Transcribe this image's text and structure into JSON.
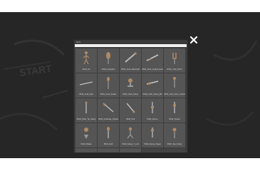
{
  "dialog": {
    "title": "Grid",
    "search_placeholder": "",
    "close_icon": "close-icon"
  },
  "colors": {
    "overlay": "#262626",
    "panel": "#3d3d3d",
    "tile": "#555555",
    "chalk": "#3a3a3a"
  },
  "background": {
    "chalk_text": "START"
  },
  "items": [
    {
      "label": "IPHD_03",
      "icon": "stick-figure-icon"
    },
    {
      "label": "IPHD_Ampedeo",
      "icon": "glove-icon"
    },
    {
      "label": "IPHD_Grab_Reanheld",
      "icon": "baton-icon"
    },
    {
      "label": "IPHD_Grab_Angled_Reach_Bat",
      "icon": "pointer-icon"
    },
    {
      "label": "IPHD_Grab_Pinch",
      "icon": "hand-icon"
    },
    {
      "label": "IPHD_Grab_Rod",
      "icon": "rod-icon"
    },
    {
      "label": "IPHD_Grab_Rotate",
      "icon": "wand-icon"
    },
    {
      "label": "IPHD_Grab_Swing",
      "icon": "lever-icon"
    },
    {
      "label": "IPHD_Grab_Swing_Mit",
      "icon": "pointer-icon"
    },
    {
      "label": "IPHD_Grab_Drive_Interlock",
      "icon": "figure-icon"
    },
    {
      "label": "IPHD_Draft_Tip_Swing",
      "icon": "needle-icon"
    },
    {
      "label": "IPHD_Clodinate_Plazed",
      "icon": "arrow-icon"
    },
    {
      "label": "IPHD_Pull",
      "icon": "pull-icon"
    },
    {
      "label": "IPHD_Plecce",
      "icon": "slider-icon"
    },
    {
      "label": "IPHD_Pocket",
      "icon": "pocket-icon"
    },
    {
      "label": "IPHD_Rotate",
      "icon": "hand-rotate-icon"
    },
    {
      "label": "IPHD_Raft",
      "icon": "paddle-icon"
    },
    {
      "label": "IPHD_Swing_T_Left",
      "icon": "swing-left-icon"
    },
    {
      "label": "IPHD_Swing_Target",
      "icon": "swing-target-icon"
    },
    {
      "label": "IPHD_Tap_Swing",
      "icon": "tap-icon"
    },
    {
      "label": "",
      "icon": "pin-icon"
    },
    {
      "label": "",
      "icon": "blank-icon"
    },
    {
      "label": "",
      "icon": "rack-icon"
    },
    {
      "label": "",
      "icon": ""
    },
    {
      "label": "",
      "icon": ""
    }
  ]
}
